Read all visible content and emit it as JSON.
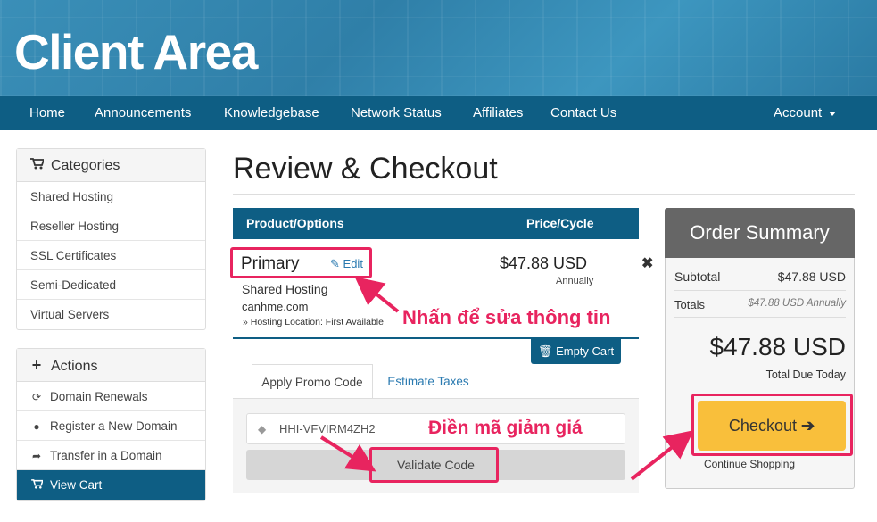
{
  "header": {
    "brand": "Client Area"
  },
  "nav": {
    "items": [
      "Home",
      "Announcements",
      "Knowledgebase",
      "Network Status",
      "Affiliates",
      "Contact Us"
    ],
    "account": "Account"
  },
  "sidebar": {
    "categories": {
      "title": "Categories",
      "icon": "shopping-cart-icon",
      "items": [
        "Shared Hosting",
        "Reseller Hosting",
        "SSL Certificates",
        "Semi-Dedicated",
        "Virtual Servers"
      ]
    },
    "actions": {
      "title": "Actions",
      "icon": "plus-icon",
      "items": [
        {
          "label": "Domain Renewals",
          "icon": "refresh-icon"
        },
        {
          "label": "Register a New Domain",
          "icon": "globe-icon"
        },
        {
          "label": "Transfer in a Domain",
          "icon": "share-icon"
        },
        {
          "label": "View Cart",
          "icon": "shopping-cart-icon",
          "active": true
        }
      ]
    }
  },
  "main": {
    "title": "Review & Checkout",
    "cart": {
      "col_product": "Product/Options",
      "col_price": "Price/Cycle",
      "item": {
        "name": "Primary",
        "edit_label": "Edit",
        "group": "Shared Hosting",
        "domain": "canhme.com",
        "location": "» Hosting Location: First Available",
        "price": "$47.88 USD",
        "cycle": "Annually"
      },
      "empty_label": "Empty Cart"
    },
    "promo": {
      "tab_apply": "Apply Promo Code",
      "tab_estimate": "Estimate Taxes",
      "code_value": "HHI-VFVIRM4ZH2",
      "validate_label": "Validate Code"
    }
  },
  "summary": {
    "title": "Order Summary",
    "subtotal_label": "Subtotal",
    "subtotal_value": "$47.88 USD",
    "totals_label": "Totals",
    "totals_value": "$47.88 USD Annually",
    "total_due": "$47.88 USD",
    "total_due_label": "Total Due Today",
    "checkout_label": "Checkout",
    "continue_label": "Continue Shopping"
  },
  "annotations": {
    "edit_note": "Nhấn để sửa thông tin",
    "promo_note": "Điền mã giảm giá",
    "color": "#e8245f"
  },
  "colors": {
    "nav": "#0e5e84",
    "checkout": "#f9bf3b",
    "summary_head": "#666666"
  }
}
